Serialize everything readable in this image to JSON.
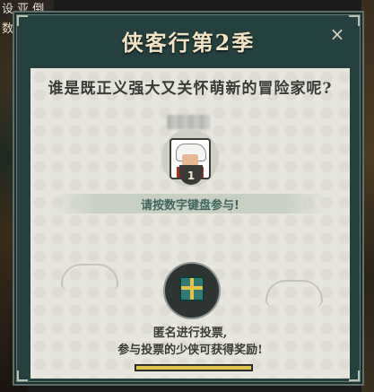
{
  "scene": {
    "top_text": "设 亚 倒数"
  },
  "dialog": {
    "title": "侠客行第2季",
    "close_symbol": "×",
    "question": "谁是既正义强大又关怀萌新的冒险家呢?",
    "candidate": {
      "vote_count": "1"
    },
    "hint": "请按数字键盘参与!",
    "info_line1": "匿名进行投票,",
    "info_line2": "参与投票的少侠可获得奖励!",
    "progress_fraction": 1.0
  },
  "colors": {
    "frame": "#24413f",
    "panel": "#e6e5de",
    "title": "#f0e4c4",
    "accent": "#e0c24c",
    "hint": "#41665e"
  },
  "icons": {
    "close": "close-icon",
    "avatar": "character-avatar-icon",
    "reward": "gift-box-icon"
  }
}
